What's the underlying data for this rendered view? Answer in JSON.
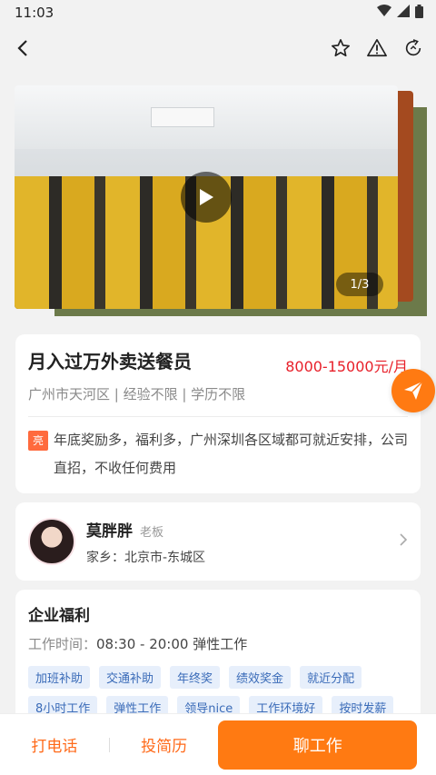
{
  "status_bar": {
    "time": "11:03"
  },
  "nav": {
    "back_icon": "back-arrow-icon",
    "star_icon": "star-icon",
    "report_icon": "warning-icon",
    "share_icon": "share-icon"
  },
  "media": {
    "pager": "1/3"
  },
  "job": {
    "title": "月入过万外卖送餐员",
    "salary": "8000-15000元/月",
    "meta": "广州市天河区 | 经验不限 | 学历不限",
    "highlight_badge": "亮",
    "description": "年底奖励多，福利多，广州深圳各区域都可就近安排，公司直招，不收任何费用"
  },
  "boss": {
    "name": "莫胖胖",
    "role": "老板",
    "hometown": "家乡：北京市-东城区"
  },
  "welfare": {
    "title": "企业福利",
    "worktime_label": "工作时间：",
    "worktime_value": "08:30 - 20:00 弹性工作",
    "tags": [
      "加班补助",
      "交通补助",
      "年终奖",
      "绩效奖金",
      "就近分配",
      "8小时工作",
      "弹性工作",
      "领导nice",
      "工作环境好",
      "按时发薪"
    ]
  },
  "bottom_bar": {
    "call_label": "打电话",
    "resume_label": "投简历",
    "chat_label": "聊工作"
  },
  "colors": {
    "accent": "#ff7a12",
    "salary": "#e8202a",
    "tag_bg": "#e7effb",
    "tag_text": "#3a6bb8"
  }
}
